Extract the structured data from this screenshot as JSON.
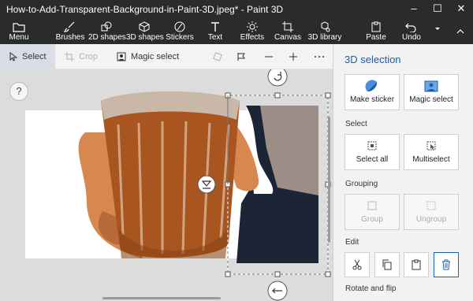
{
  "window": {
    "title": "How-to-Add-Transparent-Background-in-Paint-3D.jpeg* - Paint 3D",
    "controls": {
      "minimize": "–",
      "maximize": "☐",
      "close": "✕"
    }
  },
  "ribbon": {
    "menu": "Menu",
    "tools": [
      "Brushes",
      "2D shapes",
      "3D shapes",
      "Stickers",
      "Text",
      "Effects",
      "Canvas",
      "3D library"
    ],
    "paste": "Paste",
    "undo": "Undo"
  },
  "toolbar": {
    "select": "Select",
    "crop": "Crop",
    "magic_select": "Magic select"
  },
  "canvas": {
    "help": "?"
  },
  "panel": {
    "title": "3D selection",
    "make_sticker": "Make sticker",
    "magic_select": "Magic select",
    "select_label": "Select",
    "select_all": "Select all",
    "multiselect": "Multiselect",
    "grouping_label": "Grouping",
    "group": "Group",
    "ungroup": "Ungroup",
    "edit_label": "Edit",
    "rotate_label": "Rotate and flip"
  },
  "colors": {
    "accent": "#1f5fa8",
    "chrome": "#2b2b2b",
    "panel_bg": "#f2f2f2",
    "selected_tool": "#d9dde8"
  }
}
